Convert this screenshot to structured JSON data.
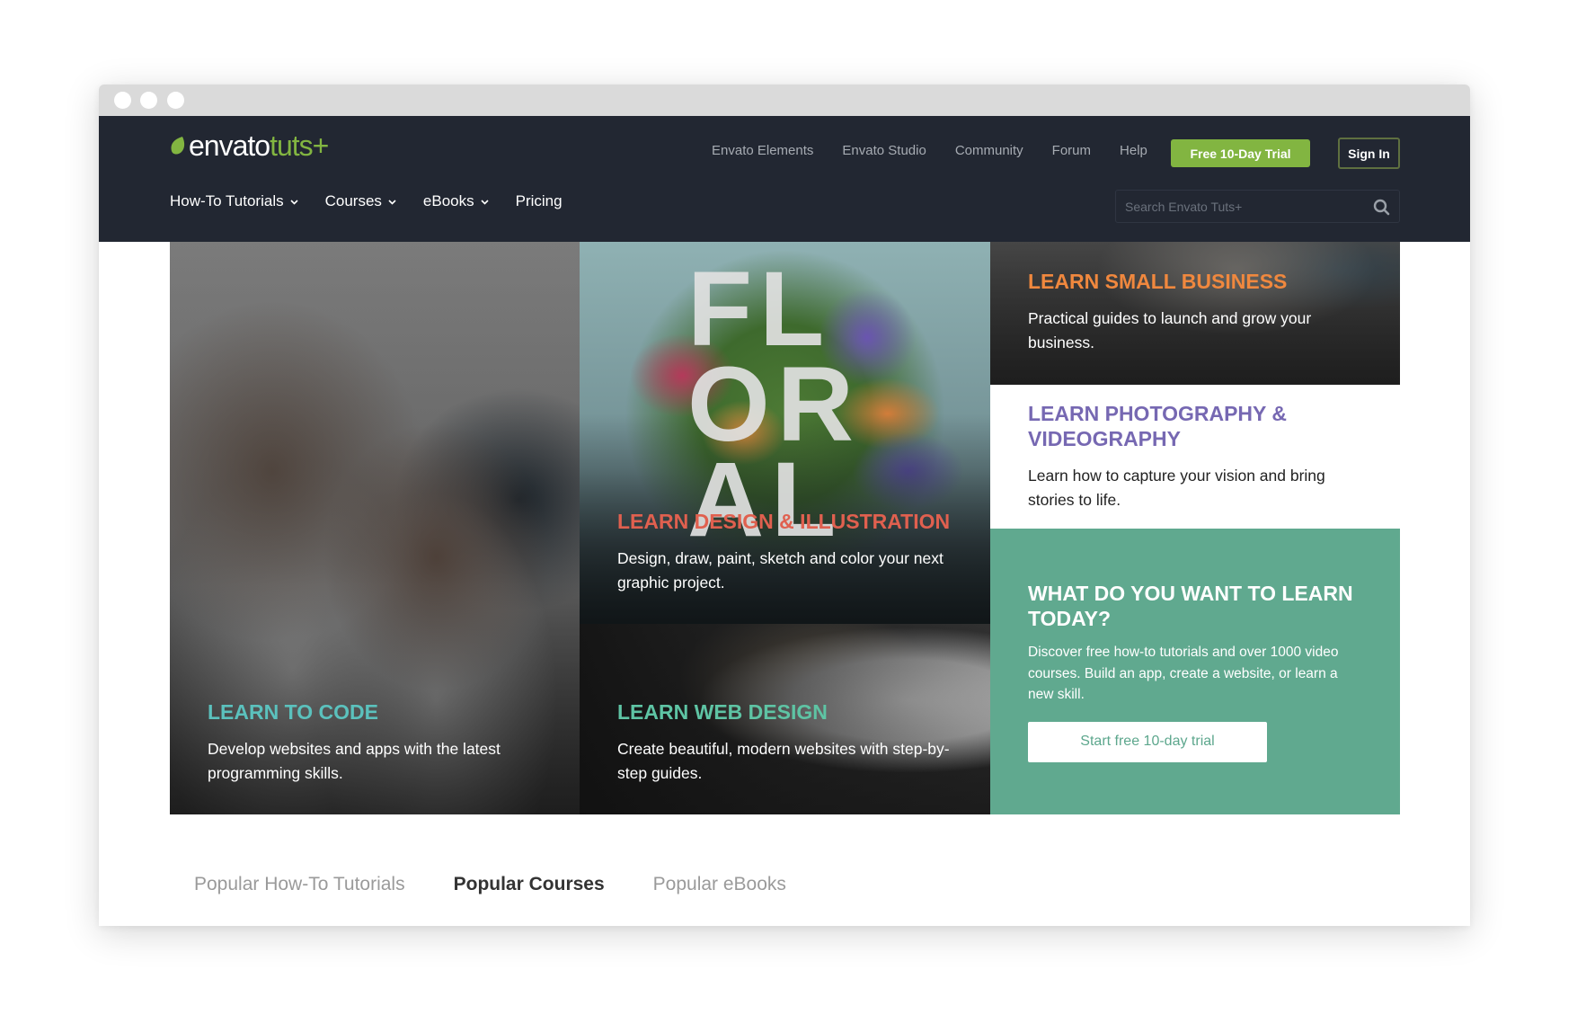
{
  "window": {
    "controls": [
      "close",
      "minimize",
      "maximize"
    ]
  },
  "brand": {
    "logo_primary": "envato",
    "logo_secondary": "tuts+",
    "accent_color": "#82b541"
  },
  "top_links": [
    {
      "label": "Envato Elements"
    },
    {
      "label": "Envato Studio"
    },
    {
      "label": "Community"
    },
    {
      "label": "Forum"
    },
    {
      "label": "Help"
    }
  ],
  "header_buttons": {
    "trial_label": "Free 10-Day Trial",
    "signin_label": "Sign In"
  },
  "main_nav": [
    {
      "label": "How-To Tutorials",
      "has_dropdown": true
    },
    {
      "label": "Courses",
      "has_dropdown": true
    },
    {
      "label": "eBooks",
      "has_dropdown": true
    },
    {
      "label": "Pricing",
      "has_dropdown": false
    }
  ],
  "search": {
    "placeholder": "Search Envato Tuts+",
    "value": "",
    "icon": "search-icon"
  },
  "tiles": {
    "code": {
      "title": "LEARN TO CODE",
      "description": "Develop websites and apps with the latest programming skills.",
      "title_color": "#5bc1bd"
    },
    "design": {
      "title": "LEARN DESIGN & ILLUSTRATION",
      "description": "Design, draw, paint, sketch and color your next graphic project.",
      "image_text": "FL OR AL",
      "title_color": "#e0604f"
    },
    "web": {
      "title": "LEARN WEB DESIGN",
      "description": "Create beautiful, modern websites with step-by-step guides.",
      "title_color": "#5ec4a4"
    },
    "business": {
      "title": "LEARN SMALL BUSINESS",
      "description": "Practical guides to launch and grow your business.",
      "title_color": "#f0883e"
    },
    "photo": {
      "title": "LEARN PHOTOGRAPHY & VIDEOGRAPHY",
      "description": "Learn how to capture your vision and bring stories to life.",
      "title_color": "#7668b2"
    },
    "cta": {
      "title": "WHAT DO YOU WANT TO LEARN TODAY?",
      "description": "Discover free how-to tutorials and over 1000 video courses. Build an app, create a website, or learn a new skill.",
      "button_label": "Start free 10-day trial",
      "background": "#60a98f"
    }
  },
  "popular_tabs": [
    {
      "label": "Popular How-To Tutorials",
      "active": false
    },
    {
      "label": "Popular Courses",
      "active": true
    },
    {
      "label": "Popular eBooks",
      "active": false
    }
  ]
}
